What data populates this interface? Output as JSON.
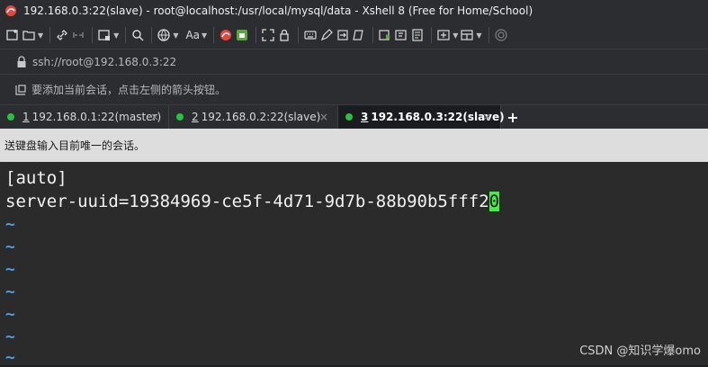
{
  "window": {
    "title": "192.168.0.3:22(slave) - root@localhost:/usr/local/mysql/data - Xshell 8 (Free for Home/School)",
    "app_icon": "xshell-logo-icon"
  },
  "toolbar": {
    "font_button_label": "Aa"
  },
  "address_bar": {
    "url": "ssh://root@192.168.0.3:22"
  },
  "hint_bar": {
    "text": "要添加当前会话，点击左侧的箭头按钮。"
  },
  "tabs": [
    {
      "number": "1",
      "label": "192.168.0.1:22(master)",
      "active": false,
      "status_color": "#25c43b"
    },
    {
      "number": "2",
      "label": "192.168.0.2:22(slave)",
      "active": false,
      "status_color": "#25c43b"
    },
    {
      "number": "3",
      "label": "192.168.0.3:22(slave)",
      "active": true,
      "status_color": "#25c43b"
    }
  ],
  "tab_close_glyph": "×",
  "tab_add_glyph": "+",
  "send_bar": {
    "text": "送键盘输入目前唯一的会话。"
  },
  "terminal": {
    "line1": "[auto]",
    "line2_before_cursor": "server-uuid=19384969-ce5f-4d71-9d7b-88b90b5fff2",
    "cursor_char": "0",
    "empty_line_marker": "~",
    "cursor_color": "#3ef23e",
    "tilde_color": "#4a9fe8"
  },
  "watermark": "CSDN @知识学爆omo"
}
